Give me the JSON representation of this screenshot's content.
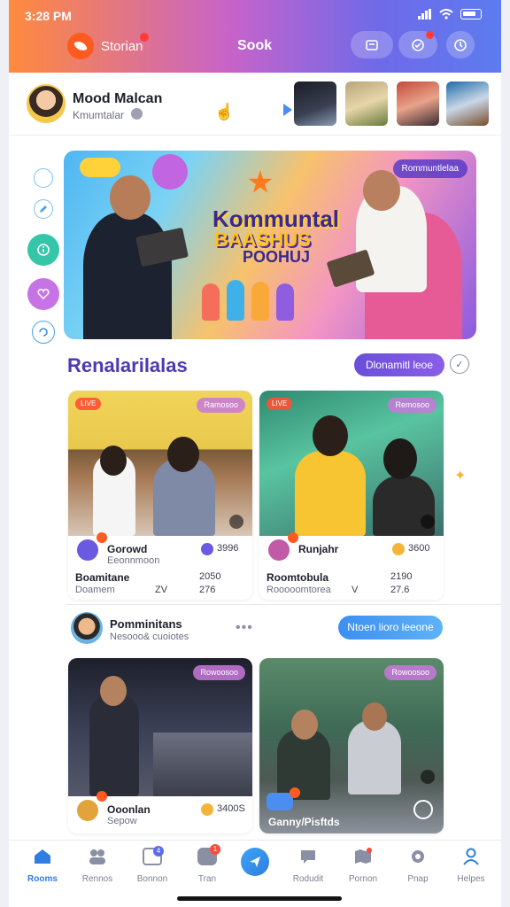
{
  "status_bar": {
    "time": "3:28 PM",
    "signal": "signal-icon",
    "wifi": "wifi-icon",
    "battery": "battery-icon"
  },
  "header": {
    "story_label": "Storian",
    "title": "Sook",
    "buttons": [
      "wallet-icon",
      "chat-icon",
      "clock-icon"
    ]
  },
  "profile": {
    "name": "Mood Malcan",
    "subtitle": "Kmumtalar"
  },
  "hero": {
    "tag": "Rommuntlelaa",
    "title_line1": "Kommuntal",
    "title_line2": "BAASHUS",
    "title_line3": "POOHUJ"
  },
  "section1": {
    "title": "Renalarilalas",
    "button": "Dlonamitl leoe",
    "cards": [
      {
        "tag": "Ramosoo",
        "user": "Gorowd",
        "subtitle": "Eeonnmoon",
        "coins": "3996",
        "stat_name": "Boamitane",
        "stat_value1": "2050",
        "stat_sub": "Doamem",
        "stat_value2": "ZV",
        "stat_value3": "276"
      },
      {
        "tag": "Remosoo",
        "user": "Runjahr",
        "subtitle": "",
        "coins": "3600",
        "stat_name": "Roomtobula",
        "stat_value1": "2190",
        "stat_sub": "Rooooomtorea",
        "stat_value2": "V",
        "stat_value3": "27.6"
      }
    ]
  },
  "section2": {
    "name": "Pomminitans",
    "subtitle": "Nesooo& cuoiotes",
    "button": "Ntoen lioro leeone",
    "cards": [
      {
        "tag": "Rowoosoo",
        "user": "Ooonlan",
        "subtitle": "Sepow",
        "coins": "3400S"
      },
      {
        "tag": "Rowoosoo",
        "user": "Ganny/Pisftds",
        "subtitle": ""
      }
    ]
  },
  "nav": {
    "items": [
      {
        "label": "Rooms",
        "icon": "home-icon",
        "badge": ""
      },
      {
        "label": "Rennos",
        "icon": "people-icon",
        "badge": ""
      },
      {
        "label": "Bonnon",
        "icon": "edit-icon",
        "badge": "4"
      },
      {
        "label": "Tran",
        "icon": "chat-icon",
        "badge": "1"
      },
      {
        "label": "",
        "icon": "send-icon",
        "badge": ""
      },
      {
        "label": "Rodudit",
        "icon": "message-icon",
        "badge": ""
      },
      {
        "label": "Pornon",
        "icon": "map-icon",
        "badge": ""
      },
      {
        "label": "Pnap",
        "icon": "gear-icon",
        "badge": ""
      },
      {
        "label": "Helpes",
        "icon": "user-icon",
        "badge": ""
      }
    ]
  },
  "colors": {
    "accent": "#4a3bb2",
    "brand": "#ff5a1f",
    "active": "#2f7de0"
  }
}
